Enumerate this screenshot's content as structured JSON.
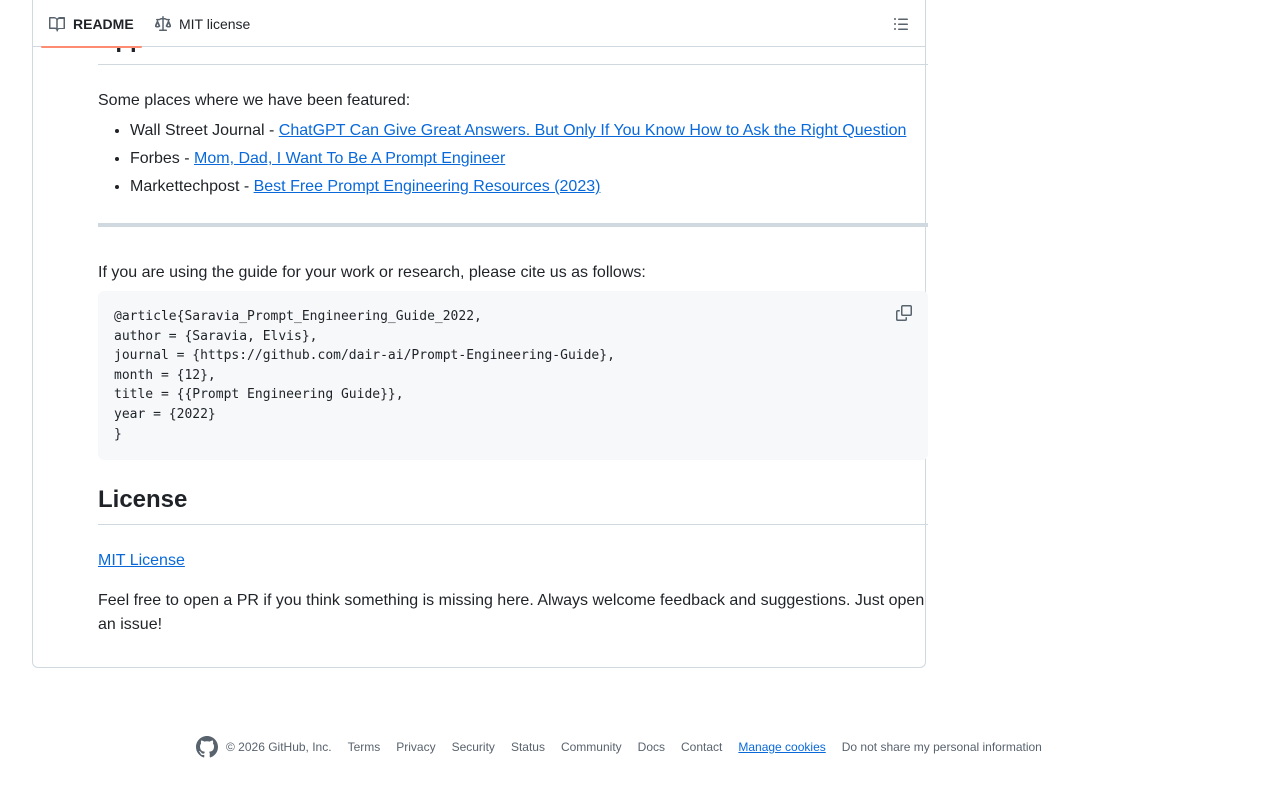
{
  "tabs": {
    "readme_label": "README",
    "license_label": "MIT license"
  },
  "appearances": {
    "heading": "Appearances",
    "intro": "Some places where we have been featured:",
    "items": [
      {
        "source": "Wall Street Journal - ",
        "link": "ChatGPT Can Give Great Answers. But Only If You Know How to Ask the Right Question"
      },
      {
        "source": "Forbes - ",
        "link": "Mom, Dad, I Want To Be A Prompt Engineer"
      },
      {
        "source": "Markettechpost - ",
        "link": "Best Free Prompt Engineering Resources (2023)"
      }
    ]
  },
  "citation": {
    "intro": "If you are using the guide for your work or research, please cite us as follows:",
    "code": "@article{Saravia_Prompt_Engineering_Guide_2022,\nauthor = {Saravia, Elvis},\njournal = {https://github.com/dair-ai/Prompt-Engineering-Guide},\nmonth = {12},\ntitle = {{Prompt Engineering Guide}},\nyear = {2022}\n}"
  },
  "license": {
    "heading": "License",
    "link": "MIT License",
    "note": "Feel free to open a PR if you think something is missing here. Always welcome feedback and suggestions. Just open an issue!"
  },
  "footer": {
    "copyright": "© 2026 GitHub, Inc.",
    "links": [
      "Terms",
      "Privacy",
      "Security",
      "Status",
      "Community",
      "Docs",
      "Contact",
      "Manage cookies",
      "Do not share my personal information"
    ]
  },
  "icons": {
    "readme": "book-icon",
    "license": "law-icon",
    "outline": "list-icon",
    "copy": "copy-icon",
    "logo": "github-mark-icon"
  },
  "colors": {
    "link": "#0969da",
    "text": "#1f2328",
    "muted": "#59636e",
    "tab_underline": "#fd8c73",
    "code_bg": "#f6f8fa",
    "border": "#d1d9e0"
  }
}
